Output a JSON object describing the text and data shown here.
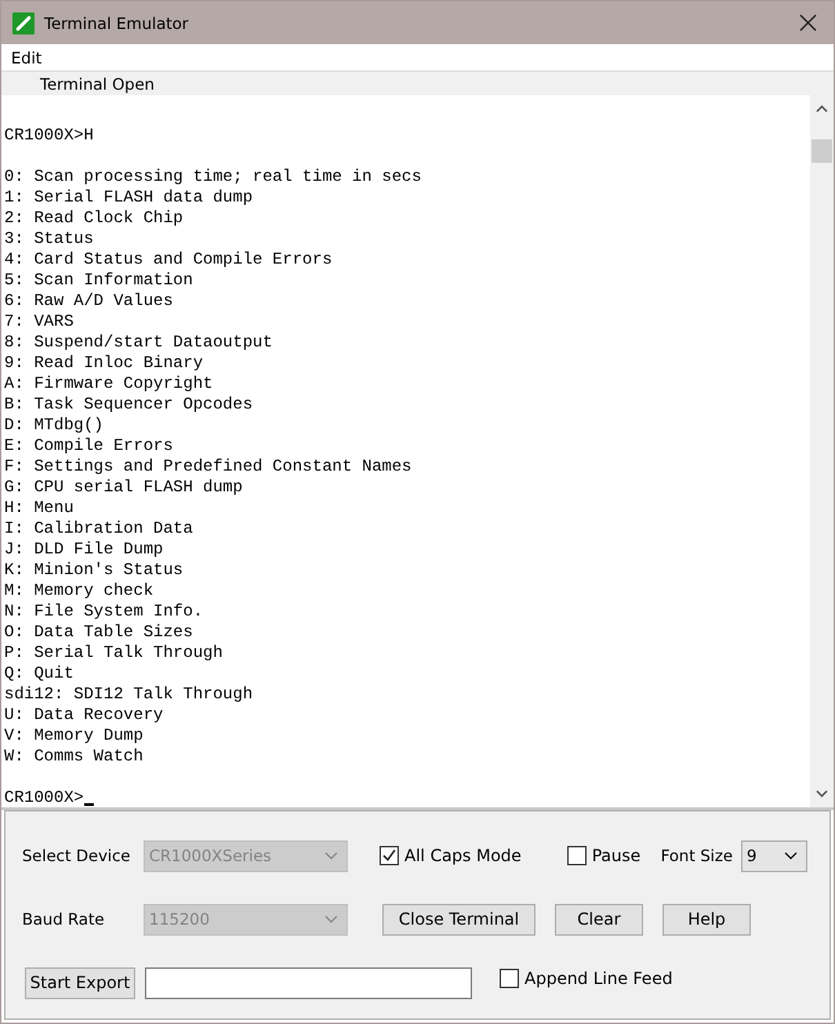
{
  "window": {
    "title": "Terminal Emulator"
  },
  "menu": [
    "Edit"
  ],
  "status": "Terminal Open",
  "terminal": {
    "blocks": [
      {
        "lines": [
          "CR1000X>H"
        ]
      },
      {
        "lines": [
          "0: Scan processing time; real time in secs",
          "1: Serial FLASH data dump",
          "2: Read Clock Chip",
          "3: Status",
          "4: Card Status and Compile Errors",
          "5: Scan Information",
          "6: Raw A/D Values",
          "7: VARS",
          "8: Suspend/start Dataoutput",
          "9: Read Inloc Binary",
          "A: Firmware Copyright",
          "B: Task Sequencer Opcodes",
          "D: MTdbg()",
          "E: Compile Errors",
          "F: Settings and Predefined Constant Names",
          "G: CPU serial FLASH dump",
          "H: Menu",
          "I: Calibration Data",
          "J: DLD File Dump",
          "K: Minion's Status",
          "M: Memory check",
          "N: File System Info.",
          "O: Data Table Sizes",
          "P: Serial Talk Through",
          "Q: Quit",
          "sdi12: SDI12 Talk Through",
          "U: Data Recovery",
          "V: Memory Dump",
          "W: Comms Watch"
        ]
      },
      {
        "lines": [
          "CR1000X>"
        ],
        "cursor": true
      }
    ]
  },
  "controls": {
    "select_device": {
      "label": "Select Device",
      "value": "CR1000XSeries",
      "disabled": true
    },
    "all_caps": {
      "label": "All Caps Mode",
      "checked": true
    },
    "pause": {
      "label": "Pause",
      "checked": false
    },
    "font_size": {
      "label": "Font Size",
      "value": "9",
      "disabled": false
    },
    "baud_rate": {
      "label": "Baud Rate",
      "value": "115200",
      "disabled": true
    },
    "buttons": [
      "Close Terminal",
      "Clear",
      "Help"
    ],
    "start_export": "Start Export",
    "append_line_feed": {
      "label": "Append Line Feed",
      "checked": false
    }
  }
}
